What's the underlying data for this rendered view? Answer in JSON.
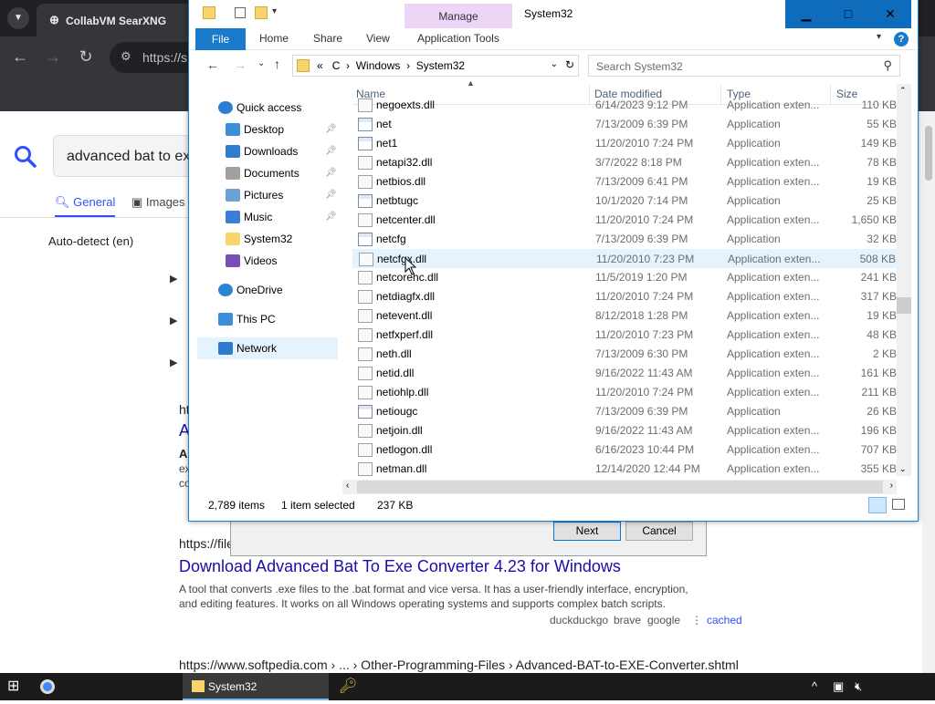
{
  "browser": {
    "tab_title": "CollabVM SearXNG",
    "url_partial": "https://s"
  },
  "searx": {
    "query": "advanced bat to exe",
    "tabs": [
      "General",
      "Images"
    ],
    "autodetect": "Auto-detect (en)",
    "result1": {
      "url": "https://file",
      "title": "Download Advanced Bat To Exe Converter 4.23 for Windows",
      "desc_line1": "A tool that converts .exe files to the .bat format and vice versa. It has a user-friendly interface, encryption,",
      "desc_line2": "and editing features. It works on all Windows operating systems and supports complex batch scripts.",
      "engines": [
        "duckduckgo",
        "brave",
        "google"
      ],
      "cached": "cached"
    },
    "result2_url": "https://www.softpedia.com › ... › Other-Programming-Files › Advanced-BAT-to-EXE-Converter.shtml",
    "partial_left": [
      "ht",
      "A",
      "A",
      "ex",
      "co"
    ]
  },
  "wizard": {
    "next": "Next",
    "cancel": "Cancel"
  },
  "explorer": {
    "context_tab": "Manage",
    "window_title": "System32",
    "ribbon": {
      "file": "File",
      "home": "Home",
      "share": "Share",
      "view": "View",
      "app_tools": "Application Tools"
    },
    "address": {
      "chevron": "«",
      "parts": [
        "C",
        "Windows",
        "System32"
      ]
    },
    "search_placeholder": "Search System32",
    "nav": [
      {
        "label": "Quick access",
        "icon": "star-icon"
      },
      {
        "label": "Desktop",
        "icon": "desktop-icon",
        "pinned": true
      },
      {
        "label": "Downloads",
        "icon": "download-icon",
        "pinned": true
      },
      {
        "label": "Documents",
        "icon": "documents-icon",
        "pinned": true
      },
      {
        "label": "Pictures",
        "icon": "pictures-icon",
        "pinned": true
      },
      {
        "label": "Music",
        "icon": "music-icon",
        "pinned": true
      },
      {
        "label": "System32",
        "icon": "folder-icon"
      },
      {
        "label": "Videos",
        "icon": "videos-icon"
      },
      {
        "label": "OneDrive",
        "icon": "cloud-icon"
      },
      {
        "label": "This PC",
        "icon": "computer-icon"
      },
      {
        "label": "Network",
        "icon": "network-icon"
      }
    ],
    "columns": [
      "Name",
      "Date modified",
      "Type",
      "Size"
    ],
    "files": [
      {
        "name": "negoexts.dll",
        "date": "6/14/2023 9:12 PM",
        "type": "Application exten...",
        "size": "110 KB",
        "kind": "dll"
      },
      {
        "name": "net",
        "date": "7/13/2009 6:39 PM",
        "type": "Application",
        "size": "55 KB",
        "kind": "exe"
      },
      {
        "name": "net1",
        "date": "11/20/2010 7:24 PM",
        "type": "Application",
        "size": "149 KB",
        "kind": "exe"
      },
      {
        "name": "netapi32.dll",
        "date": "3/7/2022 8:18 PM",
        "type": "Application exten...",
        "size": "78 KB",
        "kind": "dll"
      },
      {
        "name": "netbios.dll",
        "date": "7/13/2009 6:41 PM",
        "type": "Application exten...",
        "size": "19 KB",
        "kind": "dll"
      },
      {
        "name": "netbtugc",
        "date": "10/1/2020 7:14 PM",
        "type": "Application",
        "size": "25 KB",
        "kind": "exe"
      },
      {
        "name": "netcenter.dll",
        "date": "11/20/2010 7:24 PM",
        "type": "Application exten...",
        "size": "1,650 KB",
        "kind": "dll"
      },
      {
        "name": "netcfg",
        "date": "7/13/2009 6:39 PM",
        "type": "Application",
        "size": "32 KB",
        "kind": "exe"
      },
      {
        "name": "netcfgx.dll",
        "date": "11/20/2010 7:23 PM",
        "type": "Application exten...",
        "size": "508 KB",
        "kind": "dll",
        "selected": true
      },
      {
        "name": "netcorehc.dll",
        "date": "11/5/2019 1:20 PM",
        "type": "Application exten...",
        "size": "241 KB",
        "kind": "dll"
      },
      {
        "name": "netdiagfx.dll",
        "date": "11/20/2010 7:24 PM",
        "type": "Application exten...",
        "size": "317 KB",
        "kind": "dll"
      },
      {
        "name": "netevent.dll",
        "date": "8/12/2018 1:28 PM",
        "type": "Application exten...",
        "size": "19 KB",
        "kind": "dll"
      },
      {
        "name": "netfxperf.dll",
        "date": "11/20/2010 7:23 PM",
        "type": "Application exten...",
        "size": "48 KB",
        "kind": "dll"
      },
      {
        "name": "neth.dll",
        "date": "7/13/2009 6:30 PM",
        "type": "Application exten...",
        "size": "2 KB",
        "kind": "dll"
      },
      {
        "name": "netid.dll",
        "date": "9/16/2022 11:43 AM",
        "type": "Application exten...",
        "size": "161 KB",
        "kind": "dll"
      },
      {
        "name": "netiohlp.dll",
        "date": "11/20/2010 7:24 PM",
        "type": "Application exten...",
        "size": "211 KB",
        "kind": "dll"
      },
      {
        "name": "netiougc",
        "date": "7/13/2009 6:39 PM",
        "type": "Application",
        "size": "26 KB",
        "kind": "exe"
      },
      {
        "name": "netjoin.dll",
        "date": "9/16/2022 11:43 AM",
        "type": "Application exten...",
        "size": "196 KB",
        "kind": "dll"
      },
      {
        "name": "netlogon.dll",
        "date": "6/16/2023 10:44 PM",
        "type": "Application exten...",
        "size": "707 KB",
        "kind": "dll"
      },
      {
        "name": "netman.dll",
        "date": "12/14/2020 12:44 PM",
        "type": "Application exten...",
        "size": "355 KB",
        "kind": "dll"
      }
    ],
    "status": {
      "items": "2,789 items",
      "selected": "1 item selected",
      "size": "237 KB"
    }
  },
  "taskbar": {
    "explorer_label": "System32"
  }
}
